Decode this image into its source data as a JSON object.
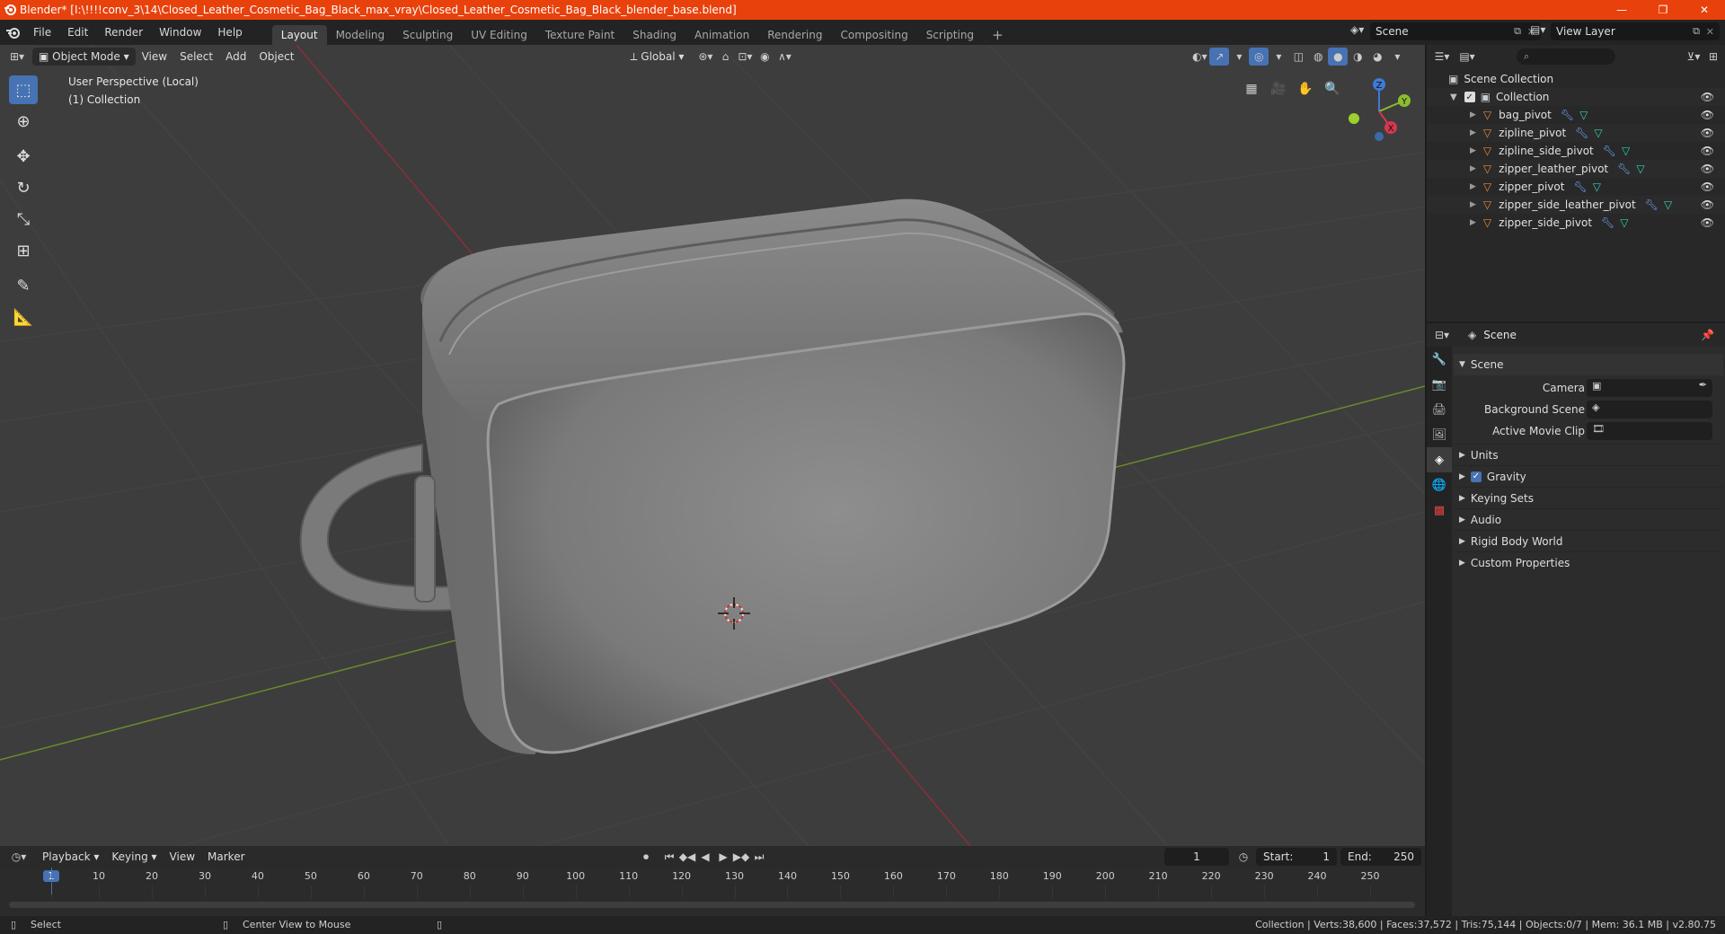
{
  "window": {
    "title": "Blender* [I:\\!!!!conv_3\\14\\Closed_Leather_Cosmetic_Bag_Black_max_vray\\Closed_Leather_Cosmetic_Bag_Black_blender_base.blend]",
    "minimize": "—",
    "maximize": "❐",
    "close": "✕"
  },
  "menus": [
    "File",
    "Edit",
    "Render",
    "Window",
    "Help"
  ],
  "workspaces": [
    "Layout",
    "Modeling",
    "Sculpting",
    "UV Editing",
    "Texture Paint",
    "Shading",
    "Animation",
    "Rendering",
    "Compositing",
    "Scripting"
  ],
  "scene_selector": "Scene",
  "view_layer_selector": "View Layer",
  "viewport": {
    "mode": "Object Mode",
    "header_menus": [
      "View",
      "Select",
      "Add",
      "Object"
    ],
    "orientation": "Global",
    "perspective_label": "User Perspective (Local)",
    "collection_label": "(1) Collection",
    "gizmo": {
      "x": "X",
      "y": "Y",
      "z": "Z"
    }
  },
  "outliner": {
    "root": "Scene Collection",
    "collection": "Collection",
    "objects": [
      "bag_pivot",
      "zipline_pivot",
      "zipline_side_pivot",
      "zipper_leather_pivot",
      "zipper_pivot",
      "zipper_side_leather_pivot",
      "zipper_side_pivot"
    ]
  },
  "properties": {
    "header": "Scene",
    "panel_title": "Scene",
    "fields": {
      "camera": "Camera",
      "background_scene": "Background Scene",
      "active_movie_clip": "Active Movie Clip"
    },
    "sections": [
      "Units",
      "Gravity",
      "Keying Sets",
      "Audio",
      "Rigid Body World",
      "Custom Properties"
    ],
    "gravity_checked": true
  },
  "timeline": {
    "menus": [
      "Playback",
      "Keying",
      "View",
      "Marker"
    ],
    "current_frame": "1",
    "start_label": "Start:",
    "start": "1",
    "end_label": "End:",
    "end": "250",
    "ruler": [
      "1",
      "10",
      "20",
      "30",
      "40",
      "50",
      "60",
      "70",
      "80",
      "90",
      "100",
      "110",
      "120",
      "130",
      "140",
      "150",
      "160",
      "170",
      "180",
      "190",
      "200",
      "210",
      "220",
      "230",
      "240",
      "250"
    ]
  },
  "statusbar": {
    "select": "Select",
    "center_view": "Center View to Mouse",
    "stats": "Collection | Verts:38,600 | Faces:37,572 | Tris:75,144 | Objects:0/7 | Mem: 36.1 MB | v2.80.75"
  },
  "colors": {
    "accent": "#4772b3",
    "titlebar": "#e8410c",
    "object_icon": "#e98a3a",
    "mesh_icon": "#2fd3b4",
    "modifier_icon": "#6fa8ff"
  }
}
